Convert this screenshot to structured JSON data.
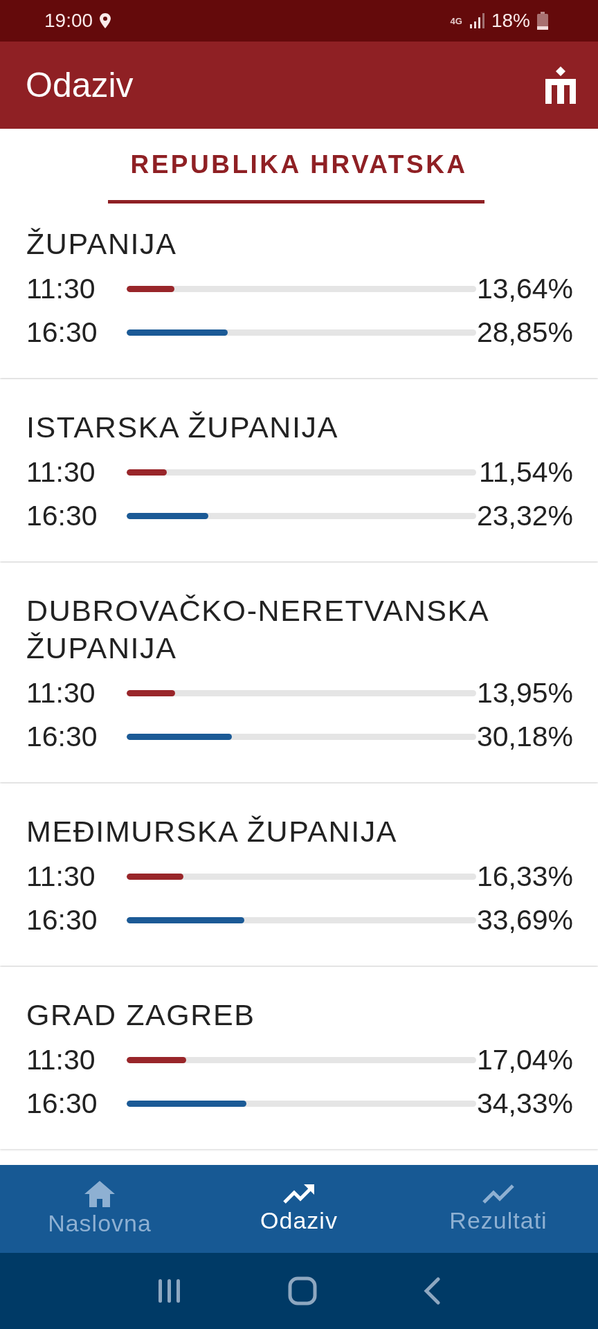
{
  "status_bar": {
    "time": "19:00",
    "network": "4G",
    "battery": "18%"
  },
  "app_bar": {
    "title": "Odaziv"
  },
  "tabs": [
    {
      "label": "REPUBLIKA HRVATSKA",
      "selected": true
    }
  ],
  "regions": [
    {
      "name": "ŽUPANIJA",
      "readings": [
        {
          "time": "11:30",
          "value": "13,64%",
          "level": 0.1364,
          "color": "#99262a"
        },
        {
          "time": "16:30",
          "value": "28,85%",
          "level": 0.2885,
          "color": "#1b5a96"
        }
      ]
    },
    {
      "name": "ISTARSKA ŽUPANIJA",
      "readings": [
        {
          "time": "11:30",
          "value": "11,54%",
          "level": 0.1154,
          "color": "#99262a"
        },
        {
          "time": "16:30",
          "value": "23,32%",
          "level": 0.2332,
          "color": "#1b5a96"
        }
      ]
    },
    {
      "name": "DUBROVAČKO-NERETVANSKA ŽUPANIJA",
      "readings": [
        {
          "time": "11:30",
          "value": "13,95%",
          "level": 0.1395,
          "color": "#99262a"
        },
        {
          "time": "16:30",
          "value": "30,18%",
          "level": 0.3018,
          "color": "#1b5a96"
        }
      ]
    },
    {
      "name": "MEĐIMURSKA ŽUPANIJA",
      "readings": [
        {
          "time": "11:30",
          "value": "16,33%",
          "level": 0.1633,
          "color": "#99262a"
        },
        {
          "time": "16:30",
          "value": "33,69%",
          "level": 0.3369,
          "color": "#1b5a96"
        }
      ]
    },
    {
      "name": "GRAD ZAGREB",
      "readings": [
        {
          "time": "11:30",
          "value": "17,04%",
          "level": 0.1704,
          "color": "#99262a"
        },
        {
          "time": "16:30",
          "value": "34,33%",
          "level": 0.3433,
          "color": "#1b5a96"
        }
      ]
    }
  ],
  "bottom_nav": [
    {
      "label": "Naslovna",
      "kind": "home",
      "selected": false
    },
    {
      "label": "Odaziv",
      "kind": "trend",
      "selected": true
    },
    {
      "label": "Rezultati",
      "kind": "chart",
      "selected": false
    }
  ]
}
